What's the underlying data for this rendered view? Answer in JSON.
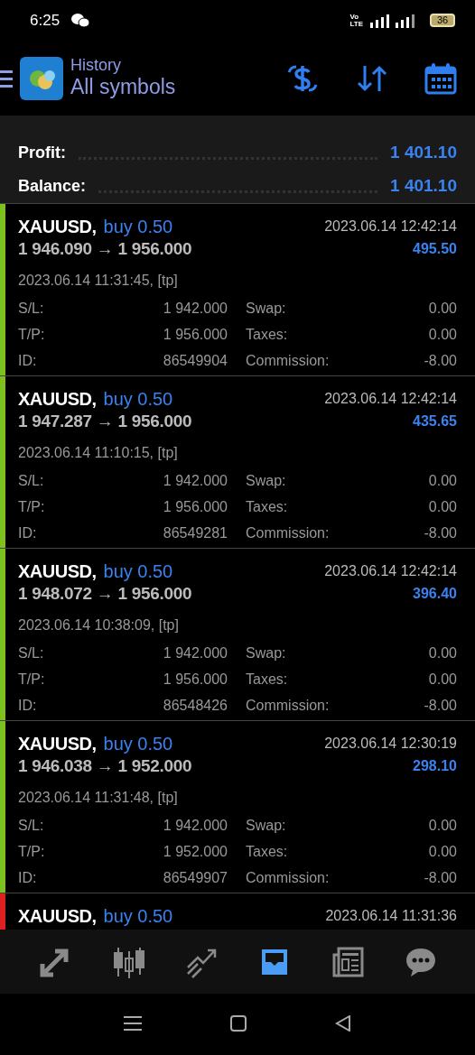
{
  "status_bar": {
    "time": "6:25",
    "network_top": "Vo",
    "network_bottom": "LTE",
    "battery": "36"
  },
  "header": {
    "title": "History",
    "subtitle": "All symbols"
  },
  "summary": [
    {
      "label": "Profit:",
      "value": "1 401.10"
    },
    {
      "label": "Balance:",
      "value": "1 401.10"
    }
  ],
  "trades": [
    {
      "symbol": "XAUUSD,",
      "side": "buy 0.50",
      "close_time": "2023.06.14 12:42:14",
      "prices": "1 946.090 → 1 956.000",
      "profit": "495.50",
      "open_time": "2023.06.14 11:31:45, [tp]",
      "color": "#7cc11e",
      "details": [
        {
          "label": "S/L:",
          "value": "1 942.000"
        },
        {
          "label": "Swap:",
          "value": "0.00"
        },
        {
          "label": "T/P:",
          "value": "1 956.000"
        },
        {
          "label": "Taxes:",
          "value": "0.00"
        },
        {
          "label": "ID:",
          "value": "86549904"
        },
        {
          "label": "Commission:",
          "value": "-8.00"
        }
      ]
    },
    {
      "symbol": "XAUUSD,",
      "side": "buy 0.50",
      "close_time": "2023.06.14 12:42:14",
      "prices": "1 947.287 → 1 956.000",
      "profit": "435.65",
      "open_time": "2023.06.14 11:10:15, [tp]",
      "color": "#7cc11e",
      "details": [
        {
          "label": "S/L:",
          "value": "1 942.000"
        },
        {
          "label": "Swap:",
          "value": "0.00"
        },
        {
          "label": "T/P:",
          "value": "1 956.000"
        },
        {
          "label": "Taxes:",
          "value": "0.00"
        },
        {
          "label": "ID:",
          "value": "86549281"
        },
        {
          "label": "Commission:",
          "value": "-8.00"
        }
      ]
    },
    {
      "symbol": "XAUUSD,",
      "side": "buy 0.50",
      "close_time": "2023.06.14 12:42:14",
      "prices": "1 948.072 → 1 956.000",
      "profit": "396.40",
      "open_time": "2023.06.14 10:38:09, [tp]",
      "color": "#7cc11e",
      "details": [
        {
          "label": "S/L:",
          "value": "1 942.000"
        },
        {
          "label": "Swap:",
          "value": "0.00"
        },
        {
          "label": "T/P:",
          "value": "1 956.000"
        },
        {
          "label": "Taxes:",
          "value": "0.00"
        },
        {
          "label": "ID:",
          "value": "86548426"
        },
        {
          "label": "Commission:",
          "value": "-8.00"
        }
      ]
    },
    {
      "symbol": "XAUUSD,",
      "side": "buy 0.50",
      "close_time": "2023.06.14 12:30:19",
      "prices": "1 946.038 → 1 952.000",
      "profit": "298.10",
      "open_time": "2023.06.14 11:31:48, [tp]",
      "color": "#7cc11e",
      "details": [
        {
          "label": "S/L:",
          "value": "1 942.000"
        },
        {
          "label": "Swap:",
          "value": "0.00"
        },
        {
          "label": "T/P:",
          "value": "1 952.000"
        },
        {
          "label": "Taxes:",
          "value": "0.00"
        },
        {
          "label": "ID:",
          "value": "86549907"
        },
        {
          "label": "Commission:",
          "value": "-8.00"
        }
      ]
    },
    {
      "symbol": "XAUUSD,",
      "side": "buy 0.50",
      "close_time": "2023.06.14 11:31:36",
      "color": "#e02020"
    }
  ],
  "bottom_nav": [
    {
      "kind": "trade",
      "selected": false
    },
    {
      "kind": "quotes",
      "selected": false
    },
    {
      "kind": "chart",
      "selected": false
    },
    {
      "kind": "history",
      "selected": true
    },
    {
      "kind": "news",
      "selected": false
    },
    {
      "kind": "chat",
      "selected": false
    }
  ]
}
